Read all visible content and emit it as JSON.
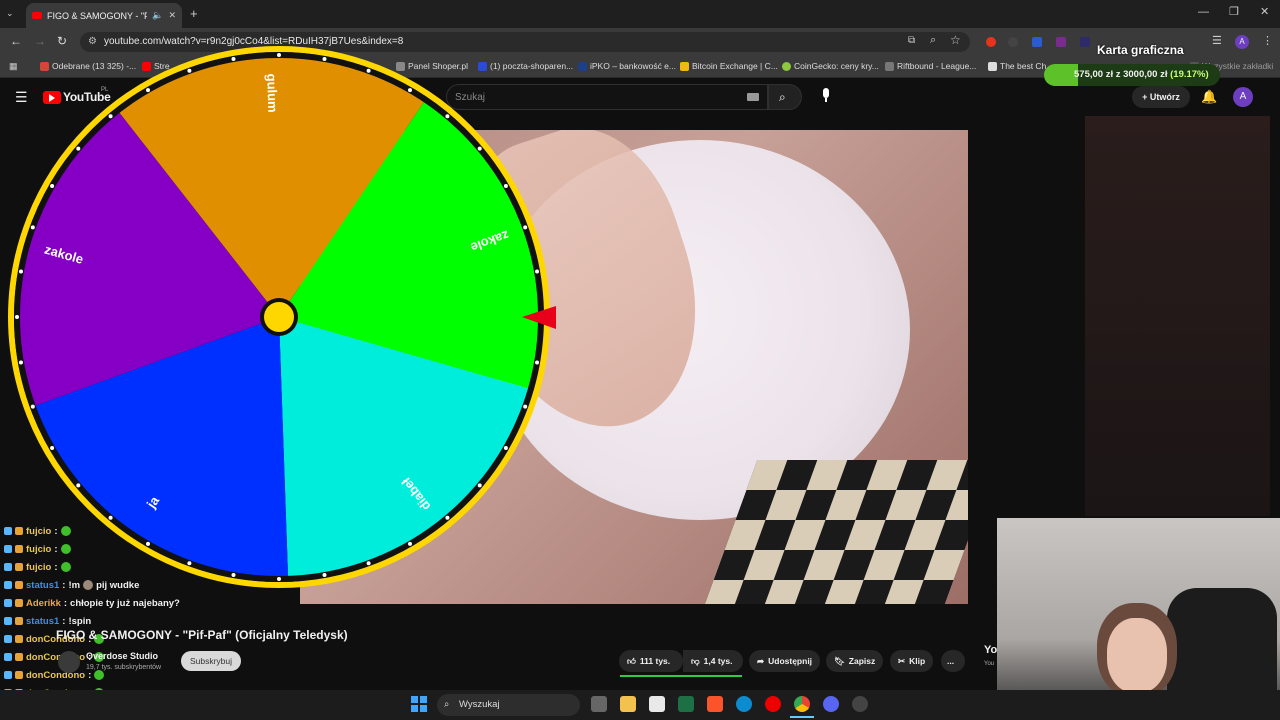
{
  "browser": {
    "tab_title": "FIGO & SAMOGONY - \"Pif-",
    "url": "youtube.com/watch?v=r9n2gj0cCo4&list=RDuIH37jB7Ues&index=8",
    "bookmarks": [
      "Odebrane (13 325) -...",
      "Stre",
      "Panel Shoper.pl",
      "(1) poczta-shoparen...",
      "iPKO – bankowość e...",
      "Bitcoin Exchange | C...",
      "CoinGecko: ceny kry...",
      "Riftbound - League...",
      "The best Ch",
      "Wszystkie zakładki"
    ]
  },
  "youtube": {
    "logo": "YouTube",
    "logo_region": "PL",
    "search_placeholder": "Szukaj",
    "create_label": "Utwórz",
    "avatar_letter": "A",
    "video_title": "FIGO & SAMOGONY - \"Pif-Paf\" (Oficjalny Teledysk)",
    "channel_name": "Overdose Studio",
    "subscribers": "19,7 tys. subskrybentów",
    "subscribe_label": "Subskrybuj",
    "likes": "111 tys.",
    "dislikes": "1,4 tys.",
    "share": "Udostępnij",
    "save": "Zapisz",
    "clip": "Klip",
    "more": "...",
    "side_text": "Yo",
    "side_subtext": "You"
  },
  "stock_widget": {
    "title": "Karta graficzna",
    "progress_text": "575,00 zł z 3000,00 zł",
    "percent_text": "(19.17%)",
    "progress_fraction": 0.1917
  },
  "wheel": {
    "segments": [
      {
        "label": "gulum",
        "color": "#e08f00"
      },
      {
        "label": "zakole",
        "color": "#00ff00"
      },
      {
        "label": "diabeł",
        "color": "#00eddc"
      },
      {
        "label": "ja",
        "color": "#0030ff"
      },
      {
        "label": "zakole",
        "color": "#8500c4"
      }
    ],
    "rim_color": "#ffd700",
    "pointer_color": "#e8001a"
  },
  "chat": [
    {
      "user": "fujcio",
      "user_color": "#e8c94a",
      "message": "",
      "has_emote": true
    },
    {
      "user": "fujcio",
      "user_color": "#e8c94a",
      "message": "",
      "has_emote": true
    },
    {
      "user": "fujcio",
      "user_color": "#e8c94a",
      "message": "",
      "has_emote": true
    },
    {
      "user": "status1",
      "user_color": "#3c8fe8",
      "message": "!m",
      "message2": "pij wudke",
      "has_emote": true
    },
    {
      "user": "Aderikk",
      "user_color": "#e8a94a",
      "message": "chłopie ty już najebany?",
      "has_emote": false
    },
    {
      "user": "status1",
      "user_color": "#3c8fe8",
      "message": "!spin",
      "has_emote": false
    },
    {
      "user": "donCondono",
      "user_color": "#e8c94a",
      "message": "",
      "has_emote": true
    },
    {
      "user": "donCondono",
      "user_color": "#e8c94a",
      "message": "",
      "has_emote": true
    },
    {
      "user": "donCondono",
      "user_color": "#e8c94a",
      "message": "",
      "has_emote": true
    },
    {
      "user": "donCondono",
      "user_color": "#e8c94a",
      "message": "",
      "has_emote": true
    },
    {
      "user": "donCondono",
      "user_color": "#e8c94a",
      "message": "",
      "has_emote": true
    }
  ],
  "taskbar": {
    "search_label": "Wyszukaj"
  }
}
